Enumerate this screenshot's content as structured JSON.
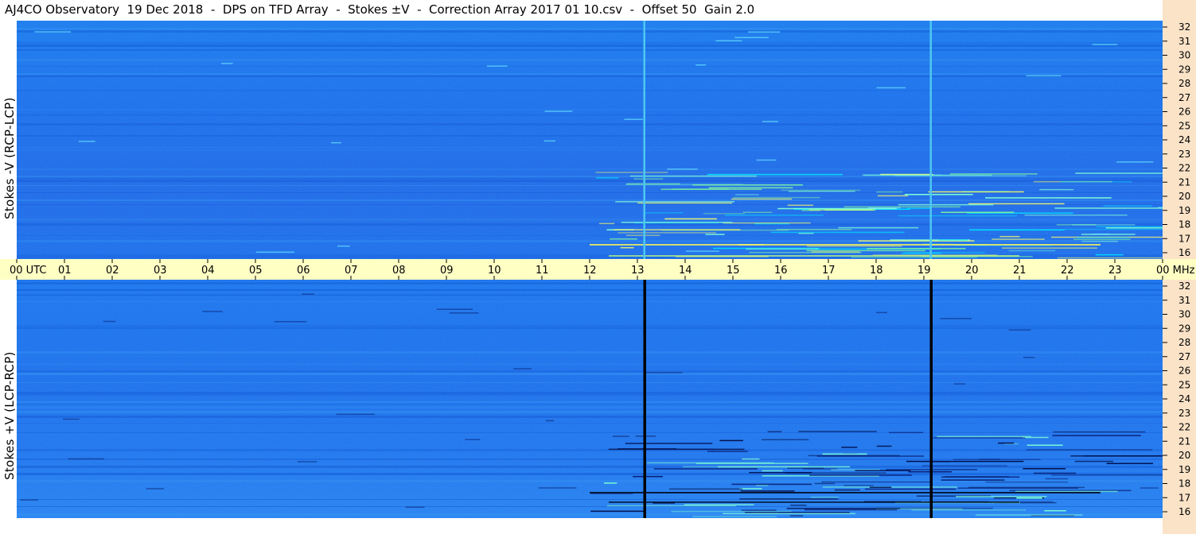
{
  "title": "AJ4CO Observatory  19 Dec 2018  -  DPS on TFD Array  -  Stokes ±V  -  Correction Array 2017 01 10.csv  -  Offset 50  Gain 2.0",
  "panels": {
    "top_label": "Stokes -V (RCP-LCP)",
    "bottom_label": "Stokes +V (LCP-RCP)"
  },
  "colors": {
    "background_blue": "#1a6ef0",
    "band_yellow": "#ffffc4",
    "axis_peach": "#fbe3c8"
  },
  "chart_data": {
    "type": "heatmap",
    "title": "AJ4CO Observatory  19 Dec 2018  -  DPS on TFD Array  -  Stokes ±V  -  Correction Array 2017 01 10.csv  -  Offset 50  Gain 2.0",
    "x_tick_labels": [
      "00 UTC",
      "01",
      "02",
      "03",
      "04",
      "05",
      "06",
      "07",
      "08",
      "09",
      "10",
      "11",
      "12",
      "13",
      "14",
      "15",
      "16",
      "17",
      "18",
      "19",
      "20",
      "21",
      "22",
      "23",
      "00 MHz"
    ],
    "x_range_utc_hours": [
      0,
      24
    ],
    "y_tick_labels": [
      "32",
      "31",
      "30",
      "29",
      "28",
      "27",
      "26",
      "25",
      "24",
      "23",
      "22",
      "21",
      "20",
      "19",
      "18",
      "17",
      "16"
    ],
    "y_range_mhz": [
      16,
      32
    ],
    "panels": [
      {
        "name": "Stokes -V (RCP-LCP)",
        "vertical_lines_utc": [
          13.15,
          19.15
        ],
        "vertical_line_color": "#4dc8f0"
      },
      {
        "name": "Stokes +V (LCP-RCP)",
        "vertical_lines_utc": [
          13.15,
          19.15
        ],
        "vertical_line_color": "#000000"
      }
    ],
    "grid": false
  }
}
